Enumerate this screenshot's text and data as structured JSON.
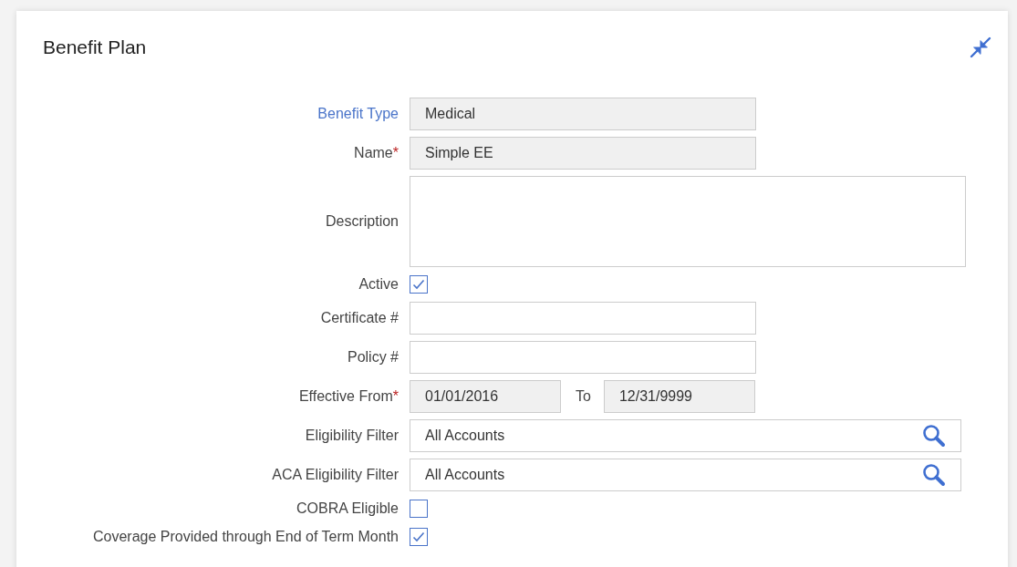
{
  "panel": {
    "title": "Benefit Plan"
  },
  "fields": [
    {
      "kind": "text",
      "label": "Benefit Type",
      "link": true,
      "value": "Medical",
      "readonly": true
    },
    {
      "kind": "text",
      "label": "Name",
      "required_mark": "*",
      "value": "Simple EE",
      "readonly": true
    },
    {
      "kind": "textarea",
      "label": "Description"
    },
    {
      "kind": "checkbox",
      "label": "Active",
      "checked": true
    },
    {
      "kind": "text",
      "label": "Certificate #",
      "readonly": false
    },
    {
      "kind": "text",
      "label": "Policy #",
      "readonly": false
    },
    {
      "kind": "daterange",
      "label": "Effective From",
      "required_mark": "*",
      "value": "01/01/2016",
      "to_label": "To",
      "to_value": "12/31/9999"
    },
    {
      "kind": "lookup",
      "label": "Eligibility Filter",
      "value": "All Accounts"
    },
    {
      "kind": "lookup",
      "label": "ACA Eligibility Filter",
      "value": "All Accounts"
    },
    {
      "kind": "checkbox",
      "label": "COBRA Eligible",
      "checked": false
    },
    {
      "kind": "checkbox",
      "label": "Coverage Provided through End of Term Month",
      "checked": true
    }
  ]
}
